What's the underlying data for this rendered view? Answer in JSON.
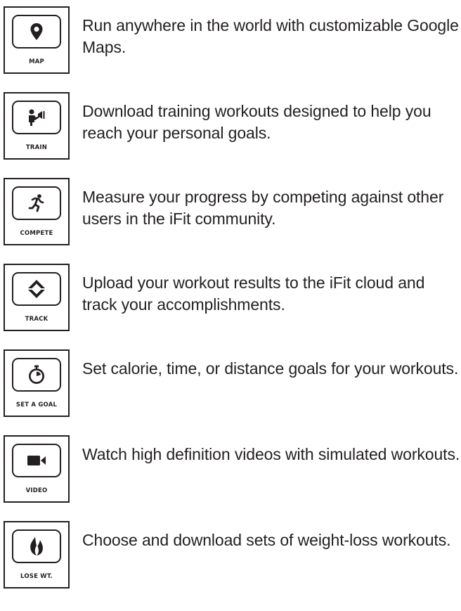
{
  "features": [
    {
      "label": "MAP",
      "icon": "map-pin-icon",
      "text": "Run anywhere in the world with customizable Google Maps."
    },
    {
      "label": "TRAIN",
      "icon": "trainer-megaphone-icon",
      "text": "Download training workouts designed to help you reach your personal goals."
    },
    {
      "label": "COMPETE",
      "icon": "runner-icon",
      "text": "Measure your progress by competing against other users in the iFit community."
    },
    {
      "label": "TRACK",
      "icon": "sync-arrows-icon",
      "text": "Upload your workout results to the iFit cloud and track your accomplishments."
    },
    {
      "label": "SET A GOAL",
      "icon": "stopwatch-icon",
      "text": "Set calorie, time, or distance goals for your workouts."
    },
    {
      "label": "VIDEO",
      "icon": "video-camera-icon",
      "text": "Watch high definition videos with simulated workouts."
    },
    {
      "label": "LOSE WT.",
      "icon": "flame-icon",
      "text": "Choose and download sets of weight-loss workouts."
    }
  ]
}
